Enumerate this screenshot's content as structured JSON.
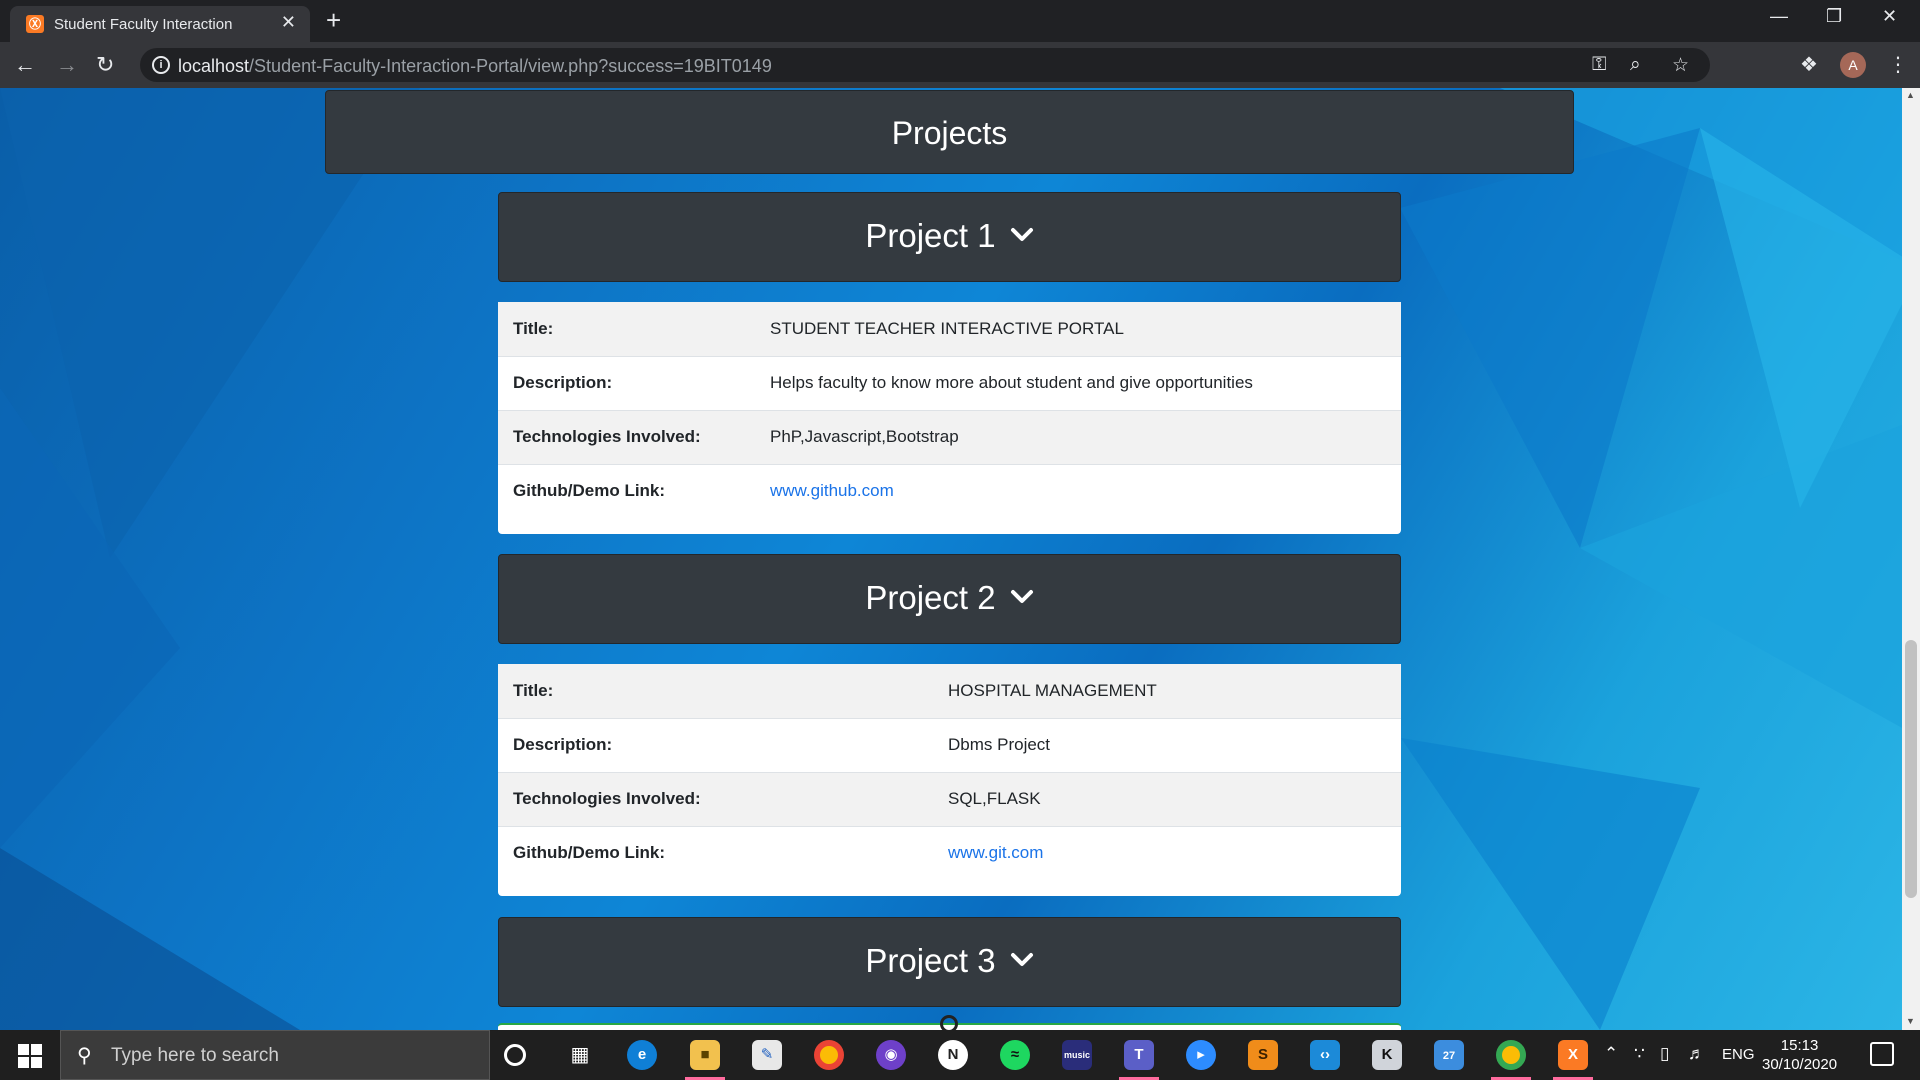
{
  "browser": {
    "tab_title": "Student Faculty Interaction",
    "favicon_text": "Ⓧ",
    "url_host": "localhost",
    "url_path": "/Student-Faculty-Interaction-Portal/view.php?success=19BIT0149",
    "avatar_letter": "A"
  },
  "page": {
    "section_title": "Projects",
    "projects": [
      {
        "header": "Project 1",
        "rows": [
          {
            "label": "Title:",
            "value": "STUDENT TEACHER INTERACTIVE PORTAL"
          },
          {
            "label": "Description:",
            "value": "Helps faculty to know more about student and give opportunities"
          },
          {
            "label": "Technologies Involved:",
            "value": "PhP,Javascript,Bootstrap"
          },
          {
            "label": "Github/Demo Link:",
            "value": "www.github.com"
          }
        ]
      },
      {
        "header": "Project 2",
        "rows": [
          {
            "label": "Title:",
            "value": "HOSPITAL MANAGEMENT"
          },
          {
            "label": "Description:",
            "value": "Dbms Project"
          },
          {
            "label": "Technologies Involved:",
            "value": "SQL,FLASK"
          },
          {
            "label": "Github/Demo Link:",
            "value": "www.git.com"
          }
        ]
      },
      {
        "header": "Project 3"
      }
    ]
  },
  "taskbar": {
    "search_placeholder": "Type here to search",
    "language": "ENG",
    "time": "15:13",
    "date": "30/10/2020",
    "badge_count": "27"
  },
  "colors": {
    "card_header_bg": "#343a40",
    "link": "#1a73e8",
    "background_blue": "#0d73c4"
  }
}
